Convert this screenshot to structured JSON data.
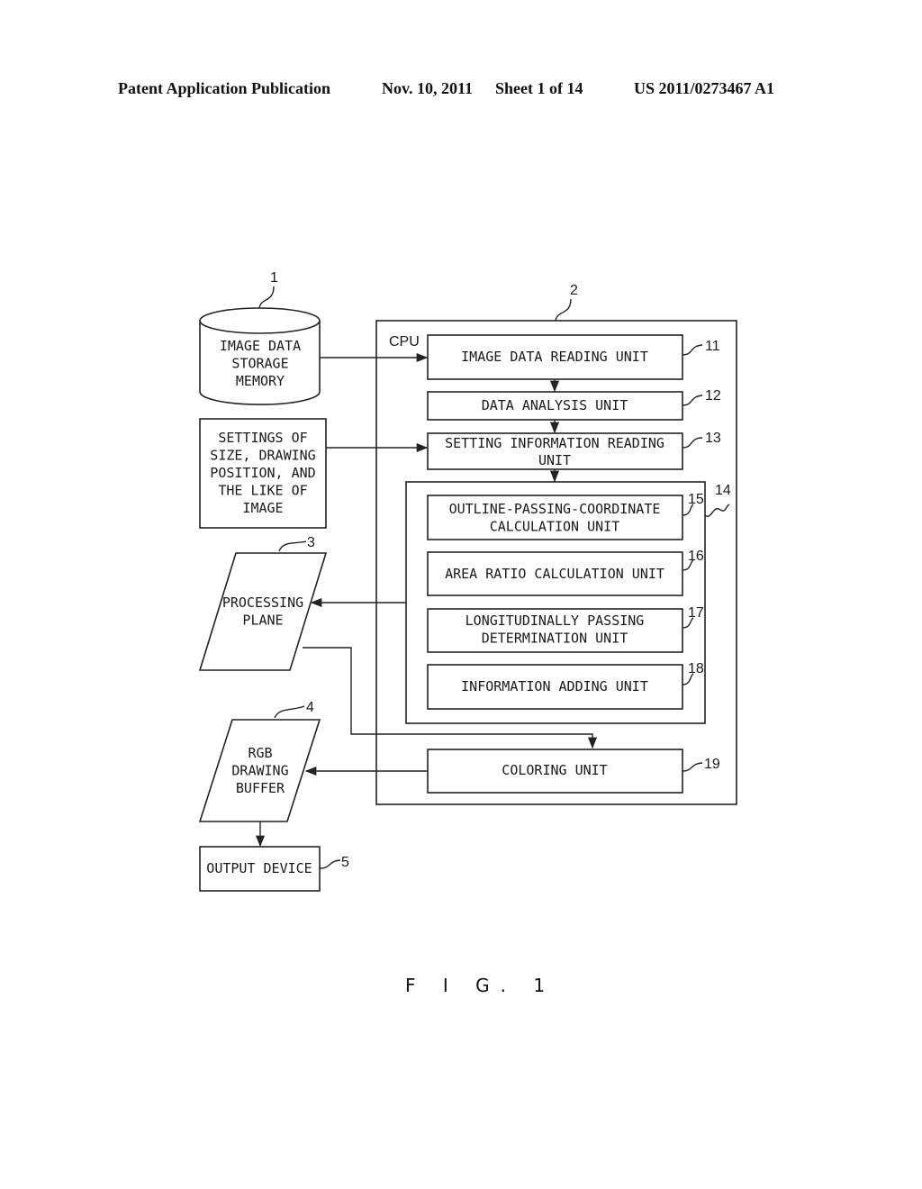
{
  "header": {
    "publication": "Patent Application Publication",
    "date": "Nov. 10, 2011",
    "sheet": "Sheet 1 of 14",
    "number": "US 2011/0273467 A1"
  },
  "figure_label": "F I G. 1",
  "nodes": {
    "storage": {
      "ref": "1",
      "lines": [
        "IMAGE DATA",
        "STORAGE",
        "MEMORY"
      ]
    },
    "settings": {
      "ref": "",
      "lines": [
        "SETTINGS OF",
        "SIZE, DRAWING",
        "POSITION, AND",
        "THE LIKE OF",
        "IMAGE"
      ]
    },
    "processing_plane": {
      "ref": "3",
      "lines": [
        "PROCESSING",
        "PLANE"
      ]
    },
    "rgb_buffer": {
      "ref": "4",
      "lines": [
        "RGB",
        "DRAWING",
        "BUFFER"
      ]
    },
    "output_device": {
      "ref": "5",
      "lines": [
        "OUTPUT DEVICE"
      ]
    },
    "cpu": {
      "ref": "2",
      "label": "CPU"
    },
    "reading_unit": {
      "ref": "11",
      "lines": [
        "IMAGE DATA READING UNIT"
      ]
    },
    "analysis_unit": {
      "ref": "12",
      "lines": [
        "DATA ANALYSIS UNIT"
      ]
    },
    "setting_reading_unit": {
      "ref": "13",
      "lines": [
        "SETTING INFORMATION READING",
        "UNIT"
      ]
    },
    "group14": {
      "ref": "14"
    },
    "outline_unit": {
      "ref": "15",
      "lines": [
        "OUTLINE-PASSING-COORDINATE",
        "CALCULATION UNIT"
      ]
    },
    "area_ratio_unit": {
      "ref": "16",
      "lines": [
        "AREA RATIO CALCULATION UNIT"
      ]
    },
    "longitudinal_unit": {
      "ref": "17",
      "lines": [
        "LONGITUDINALLY PASSING",
        "DETERMINATION UNIT"
      ]
    },
    "info_adding_unit": {
      "ref": "18",
      "lines": [
        "INFORMATION ADDING UNIT"
      ]
    },
    "coloring_unit": {
      "ref": "19",
      "lines": [
        "COLORING UNIT"
      ]
    }
  }
}
